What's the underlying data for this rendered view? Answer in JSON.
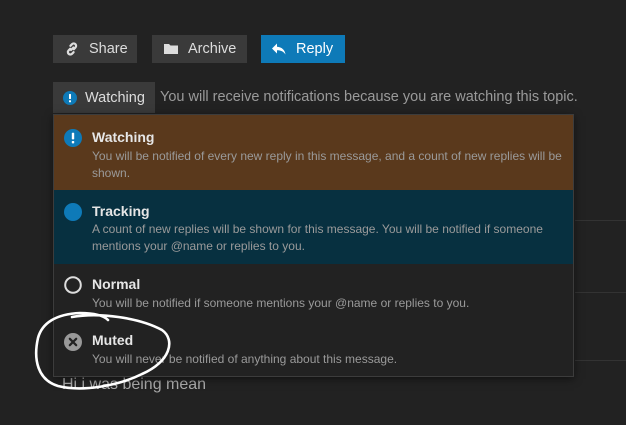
{
  "toolbar": {
    "share_label": "Share",
    "archive_label": "Archive",
    "reply_label": "Reply"
  },
  "notification": {
    "current_level_label": "Watching",
    "reason_text": "You will receive notifications because you are watching this topic."
  },
  "menu": {
    "options": [
      {
        "title": "Watching",
        "description": "You will be notified of every new reply in this message, and a count of new replies will be shown.",
        "icon": "exclamation-circle-icon",
        "color": "#0e7ab8"
      },
      {
        "title": "Tracking",
        "description": "A count of new replies will be shown for this message. You will be notified if someone mentions your @name or replies to you.",
        "icon": "filled-circle-icon",
        "color": "#0e7ab8"
      },
      {
        "title": "Normal",
        "description": "You will be notified if someone mentions your @name or replies to you.",
        "icon": "empty-circle-icon",
        "color": "#dddddd"
      },
      {
        "title": "Muted",
        "description": "You will never be notified of anything about this message.",
        "icon": "times-circle-icon",
        "color": "#999999"
      }
    ]
  },
  "background": {
    "post_text": "Hi i was being mean"
  },
  "colors": {
    "page_background": "#222222",
    "button_background": "#3a3a3a",
    "accent": "#0e7ab8",
    "watching_highlight": "#5a391c",
    "tracking_highlight": "#073040"
  }
}
